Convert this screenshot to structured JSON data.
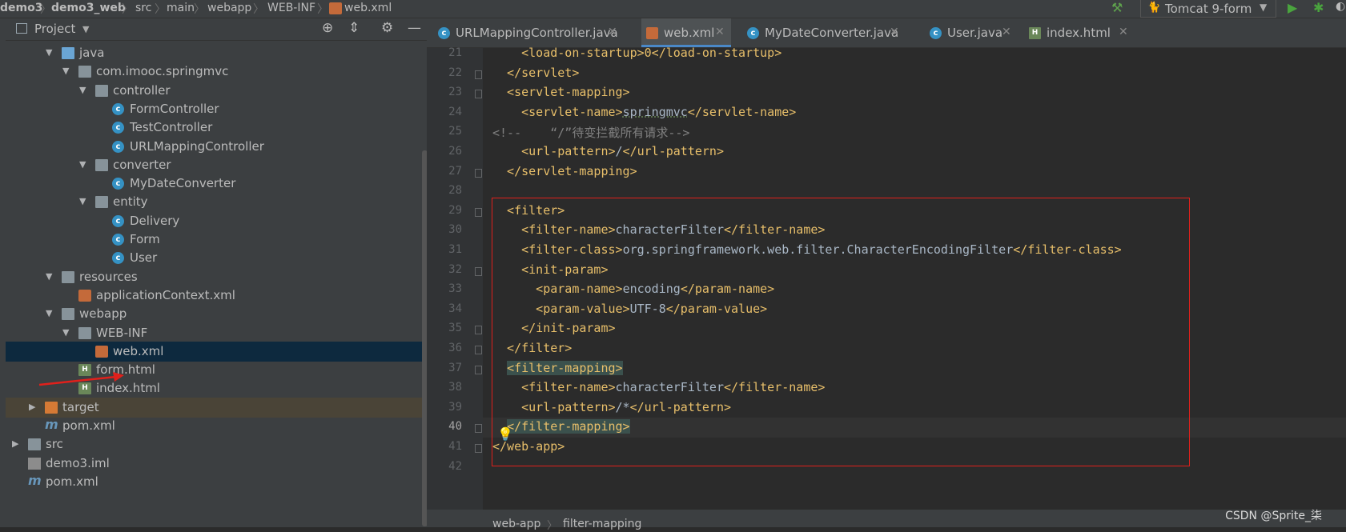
{
  "breadcrumbs": [
    "demo3",
    "demo3_web",
    "src",
    "main",
    "webapp",
    "WEB-INF",
    "web.xml"
  ],
  "run_config": {
    "label": "Tomcat 9-form"
  },
  "project_panel": {
    "title": "Project",
    "tree": [
      {
        "label": "java",
        "depth": 2,
        "arrow": "▼",
        "icon": "folder-blue"
      },
      {
        "label": "com.imooc.springmvc",
        "depth": 3,
        "arrow": "▼",
        "icon": "package"
      },
      {
        "label": "controller",
        "depth": 4,
        "arrow": "▼",
        "icon": "package"
      },
      {
        "label": "FormController",
        "depth": 5,
        "arrow": "",
        "icon": "class"
      },
      {
        "label": "TestController",
        "depth": 5,
        "arrow": "",
        "icon": "class"
      },
      {
        "label": "URLMappingController",
        "depth": 5,
        "arrow": "",
        "icon": "class"
      },
      {
        "label": "converter",
        "depth": 4,
        "arrow": "▼",
        "icon": "package"
      },
      {
        "label": "MyDateConverter",
        "depth": 5,
        "arrow": "",
        "icon": "class"
      },
      {
        "label": "entity",
        "depth": 4,
        "arrow": "▼",
        "icon": "package"
      },
      {
        "label": "Delivery",
        "depth": 5,
        "arrow": "",
        "icon": "class"
      },
      {
        "label": "Form",
        "depth": 5,
        "arrow": "",
        "icon": "class"
      },
      {
        "label": "User",
        "depth": 5,
        "arrow": "",
        "icon": "class"
      },
      {
        "label": "resources",
        "depth": 2,
        "arrow": "▼",
        "icon": "folder-res"
      },
      {
        "label": "applicationContext.xml",
        "depth": 3,
        "arrow": "",
        "icon": "xml"
      },
      {
        "label": "webapp",
        "depth": 2,
        "arrow": "▼",
        "icon": "folder-web"
      },
      {
        "label": "WEB-INF",
        "depth": 3,
        "arrow": "▼",
        "icon": "folder"
      },
      {
        "label": "web.xml",
        "depth": 4,
        "arrow": "",
        "icon": "xml",
        "selected": true
      },
      {
        "label": "form.html",
        "depth": 3,
        "arrow": "",
        "icon": "html"
      },
      {
        "label": "index.html",
        "depth": 3,
        "arrow": "",
        "icon": "html"
      },
      {
        "label": "target",
        "depth": 1,
        "arrow": "▶",
        "icon": "folder-orange",
        "excluded": true
      },
      {
        "label": "pom.xml",
        "depth": 1,
        "arrow": "",
        "icon": "maven"
      },
      {
        "label": "src",
        "depth": 0,
        "arrow": "▶",
        "icon": "folder"
      },
      {
        "label": "demo3.iml",
        "depth": 0,
        "arrow": "",
        "icon": "iml"
      },
      {
        "label": "pom.xml",
        "depth": 0,
        "arrow": "",
        "icon": "maven"
      }
    ]
  },
  "tabs": [
    {
      "label": "URLMappingController.java",
      "icon": "class",
      "active": false
    },
    {
      "label": "web.xml",
      "icon": "xml",
      "active": true
    },
    {
      "label": "MyDateConverter.java",
      "icon": "class",
      "active": false
    },
    {
      "label": "User.java",
      "icon": "class",
      "active": false
    },
    {
      "label": "index.html",
      "icon": "html",
      "active": false
    }
  ],
  "code_lines": [
    {
      "n": "21",
      "parts": [
        [
          "t",
          "    <load-on-startup>0</load-on-startup>"
        ]
      ]
    },
    {
      "n": "22",
      "parts": [
        [
          "t",
          "  </servlet>"
        ]
      ]
    },
    {
      "n": "23",
      "parts": [
        [
          "t",
          "  <servlet-mapping>"
        ]
      ]
    },
    {
      "n": "24",
      "parts": [
        [
          "t",
          "    <servlet-name>"
        ],
        [
          "x",
          "springmvc"
        ],
        [
          "t",
          "</servlet-name>"
        ]
      ]
    },
    {
      "n": "25",
      "parts": [
        [
          "c",
          "<!--    “/”待变拦截所有请求-->"
        ]
      ]
    },
    {
      "n": "26",
      "parts": [
        [
          "t",
          "    <url-pattern>"
        ],
        [
          "x",
          "/"
        ],
        [
          "t",
          "</url-pattern>"
        ]
      ]
    },
    {
      "n": "27",
      "parts": [
        [
          "t",
          "  </servlet-mapping>"
        ]
      ]
    },
    {
      "n": "28",
      "parts": []
    },
    {
      "n": "29",
      "parts": [
        [
          "t",
          "  <filter>"
        ]
      ]
    },
    {
      "n": "30",
      "parts": [
        [
          "t",
          "    <filter-name>"
        ],
        [
          "x",
          "characterFilter"
        ],
        [
          "t",
          "</filter-name>"
        ]
      ]
    },
    {
      "n": "31",
      "parts": [
        [
          "t",
          "    <filter-class>"
        ],
        [
          "x",
          "org.springframework.web.filter.CharacterEncodingFilter"
        ],
        [
          "t",
          "</filter-class>"
        ]
      ]
    },
    {
      "n": "32",
      "parts": [
        [
          "t",
          "    <init-param>"
        ]
      ]
    },
    {
      "n": "33",
      "parts": [
        [
          "t",
          "      <param-name>"
        ],
        [
          "x",
          "encoding"
        ],
        [
          "t",
          "</param-name>"
        ]
      ]
    },
    {
      "n": "34",
      "parts": [
        [
          "t",
          "      <param-value>"
        ],
        [
          "x",
          "UTF-8"
        ],
        [
          "t",
          "</param-value>"
        ]
      ]
    },
    {
      "n": "35",
      "parts": [
        [
          "t",
          "    </init-param>"
        ]
      ]
    },
    {
      "n": "36",
      "parts": [
        [
          "t",
          "  </filter>"
        ]
      ]
    },
    {
      "n": "37",
      "parts": [
        [
          "t",
          "  "
        ],
        [
          "h",
          "<filter-mapping>"
        ]
      ]
    },
    {
      "n": "38",
      "parts": [
        [
          "t",
          "    <filter-name>"
        ],
        [
          "x",
          "characterFilter"
        ],
        [
          "t",
          "</filter-name>"
        ]
      ]
    },
    {
      "n": "39",
      "parts": [
        [
          "t",
          "    <url-pattern>"
        ],
        [
          "x",
          "/*"
        ],
        [
          "t",
          "</url-pattern>"
        ]
      ]
    },
    {
      "n": "40",
      "parts": [
        [
          "t",
          "  "
        ],
        [
          "h",
          "</filter-mapping>"
        ]
      ],
      "current": true
    },
    {
      "n": "41",
      "parts": [
        [
          "t",
          "</web-app>"
        ]
      ]
    },
    {
      "n": "42",
      "parts": []
    }
  ],
  "status": {
    "path": [
      "web-app",
      "filter-mapping"
    ]
  },
  "watermark": "CSDN @Sprite_柒",
  "colors": {
    "tag": "#e8bf6a",
    "text": "#a9b7c6",
    "comment": "#808080",
    "highlight_box": "#e0201b",
    "selection": "#0d293e"
  }
}
